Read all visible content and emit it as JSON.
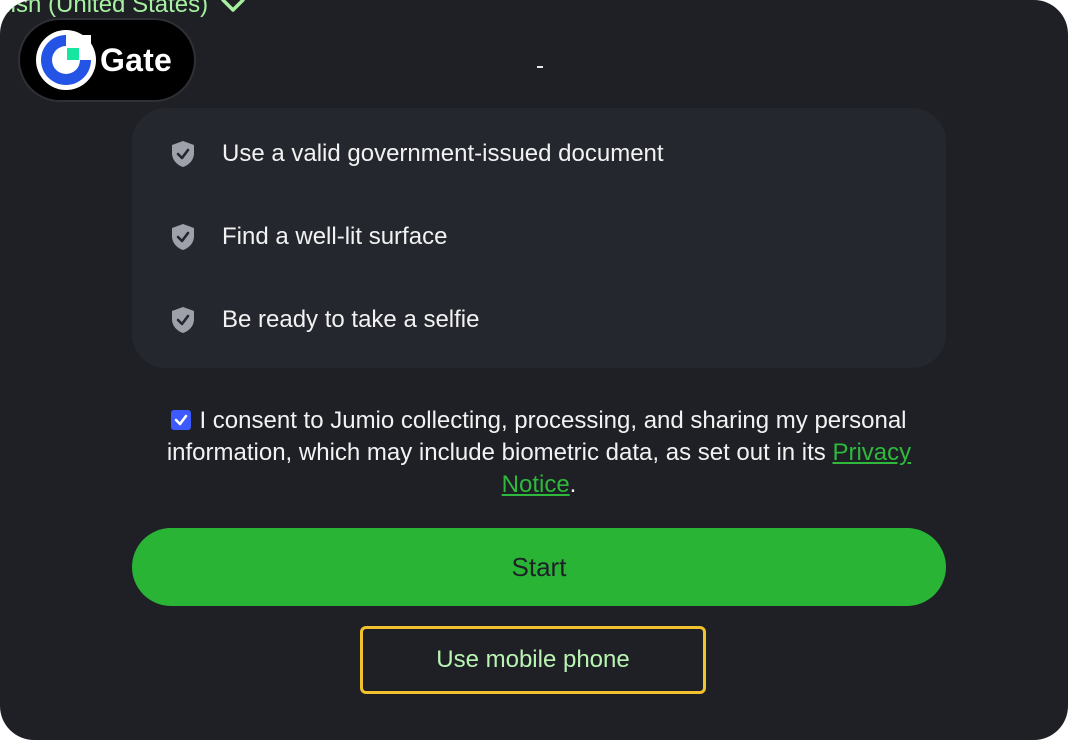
{
  "header": {
    "language_label": "glish (United States)",
    "language_icon": "chevron-down-icon",
    "logo_text": "Gate",
    "separator_text": "-"
  },
  "checklist": {
    "icon": "shield-check-icon",
    "items": [
      {
        "label": "Use a valid government-issued document"
      },
      {
        "label": "Find a well-lit surface"
      },
      {
        "label": "Be ready to take a selfie"
      }
    ]
  },
  "consent": {
    "checked": true,
    "text": "I consent to Jumio collecting, processing, and sharing my personal information, which may include biometric data, as set out in its",
    "link_text": "Privacy Notice",
    "trailing": "."
  },
  "actions": {
    "start_label": "Start",
    "mobile_label": "Use mobile phone"
  },
  "colors": {
    "background": "#1e2025",
    "card": "#25272e",
    "accent_green": "#2ab436",
    "link_green": "#2eb83c",
    "highlight_border": "#f2c12e",
    "checkbox_blue": "#3d5afe"
  }
}
